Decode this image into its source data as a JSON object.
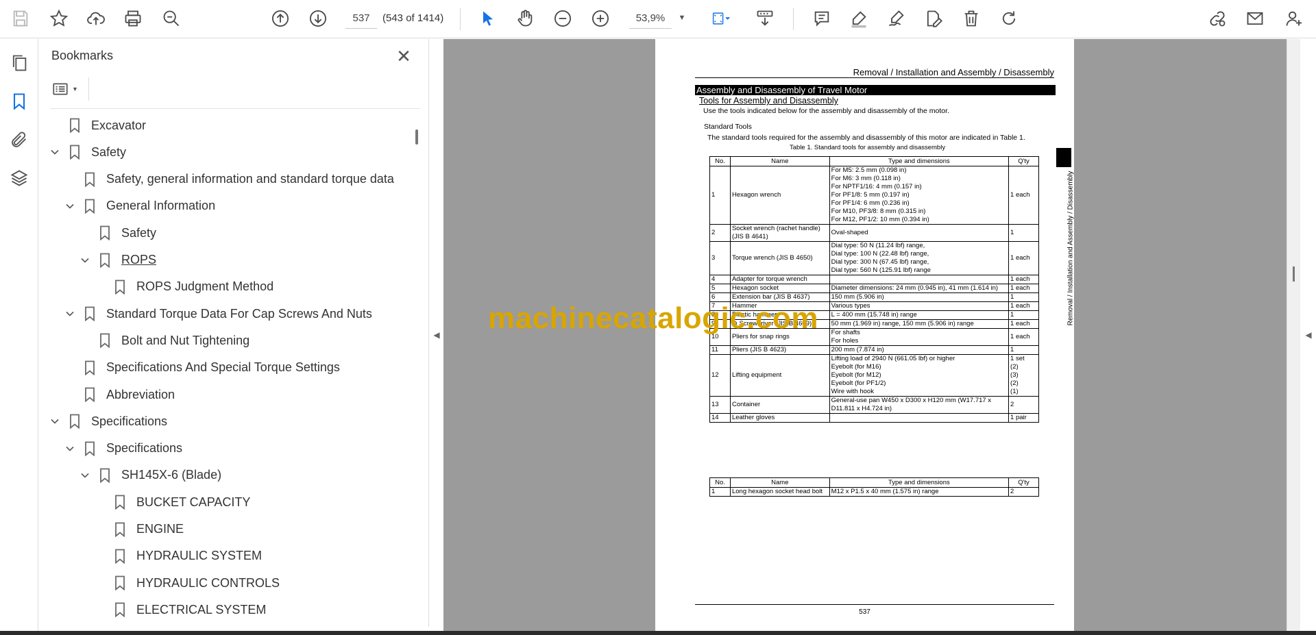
{
  "toolbar": {
    "page_number": "537",
    "page_count": "(543 of 1414)",
    "zoom": "53,9%"
  },
  "panel": {
    "title": "Bookmarks",
    "items": [
      {
        "label": "Excavator",
        "level": 0,
        "expanded": null
      },
      {
        "label": "Safety",
        "level": 0,
        "expanded": true
      },
      {
        "label": "Safety, general information and standard torque data",
        "level": 1,
        "expanded": null
      },
      {
        "label": "General Information",
        "level": 1,
        "expanded": true
      },
      {
        "label": "Safety",
        "level": 2,
        "expanded": null
      },
      {
        "label": "ROPS",
        "level": 2,
        "expanded": true
      },
      {
        "label": "ROPS Judgment Method",
        "level": 3,
        "expanded": null
      },
      {
        "label": "Standard Torque Data For Cap Screws And Nuts",
        "level": 1,
        "expanded": true
      },
      {
        "label": "Bolt and Nut Tightening",
        "level": 2,
        "expanded": null
      },
      {
        "label": "Specifications And Special Torque Settings",
        "level": 1,
        "expanded": null
      },
      {
        "label": "Abbreviation",
        "level": 1,
        "expanded": null
      },
      {
        "label": "Specifications",
        "level": 0,
        "expanded": true
      },
      {
        "label": "Specifications",
        "level": 1,
        "expanded": true
      },
      {
        "label": "SH145X-6 (Blade)",
        "level": 2,
        "expanded": true
      },
      {
        "label": "BUCKET CAPACITY",
        "level": 3,
        "expanded": null
      },
      {
        "label": "ENGINE",
        "level": 3,
        "expanded": null
      },
      {
        "label": "HYDRAULIC SYSTEM",
        "level": 3,
        "expanded": null
      },
      {
        "label": "HYDRAULIC CONTROLS",
        "level": 3,
        "expanded": null
      },
      {
        "label": "ELECTRICAL SYSTEM",
        "level": 3,
        "expanded": null
      }
    ]
  },
  "document": {
    "header": "Removal / Installation and Assembly / Disassembly",
    "section_title": "Assembly and Disassembly of Travel Motor",
    "subsection_title": "Tools for Assembly and Disassembly",
    "intro": "Use the tools indicated below for the assembly and disassembly of the motor.",
    "standard_tools_heading": "Standard Tools",
    "standard_tools_text": "The standard tools required for the assembly and disassembly of this motor are indicated in Table 1.",
    "table_caption": "Table 1. Standard tools for assembly and disassembly",
    "side_label": "Removal / Installation and Assembly / Disassembly",
    "columns": [
      "No.",
      "Name",
      "Type and dimensions",
      "Q'ty"
    ],
    "table1": [
      {
        "no": "1",
        "name": "Hexagon wrench",
        "type": [
          "For M5: 2.5 mm (0.098 in)",
          "For M6: 3 mm (0.118 in)",
          "For NPTF1/16: 4 mm (0.157 in)",
          "For PF1/8: 5 mm (0.197 in)",
          "For PF1/4: 6 mm (0.236 in)",
          "For M10, PF3/8: 8 mm (0.315 in)",
          "For M12, PF1/2: 10 mm (0.394 in)"
        ],
        "qty": [
          "1 each"
        ]
      },
      {
        "no": "2",
        "name": "Socket wrench (rachet handle) (JIS B 4641)",
        "type": [
          "Oval-shaped"
        ],
        "qty": [
          "1"
        ]
      },
      {
        "no": "3",
        "name": "Torque wrench (JIS B 4650)",
        "type": [
          "Dial type: 50 N (11.24 lbf) range,",
          "Dial type: 100 N (22.48 lbf) range,",
          "Dial type: 300 N (67.45 lbf) range,",
          "Dial type: 560 N (125.91 lbf) range"
        ],
        "qty": [
          "1 each"
        ]
      },
      {
        "no": "4",
        "name": "Adapter for torque wrench",
        "type": [
          ""
        ],
        "qty": [
          "1 each"
        ]
      },
      {
        "no": "5",
        "name": "Hexagon socket",
        "type": [
          "Diameter dimensions: 24 mm (0.945 in), 41 mm (1.614 in)"
        ],
        "qty": [
          "1 each"
        ]
      },
      {
        "no": "6",
        "name": "Extension bar (JIS B 4637)",
        "type": [
          "150 mm (5.906 in)"
        ],
        "qty": [
          "1"
        ]
      },
      {
        "no": "7",
        "name": "Hammer",
        "type": [
          "Various types"
        ],
        "qty": [
          "1 each"
        ]
      },
      {
        "no": "8",
        "name": "Plastic hammer",
        "type": [
          "L = 400 mm (15.748 in) range"
        ],
        "qty": [
          "1"
        ]
      },
      {
        "no": "9",
        "name": "⊖ Screwdriver (JIS B 4609)",
        "type": [
          "50 mm (1.969 in) range, 150 mm (5.906 in) range"
        ],
        "qty": [
          "1 each"
        ]
      },
      {
        "no": "10",
        "name": "Pliers for snap rings",
        "type": [
          "For shafts",
          "For holes"
        ],
        "qty": [
          "1 each"
        ]
      },
      {
        "no": "11",
        "name": "Pliers (JIS B 4623)",
        "type": [
          "200 mm (7.874 in)"
        ],
        "qty": [
          "1"
        ]
      },
      {
        "no": "12",
        "name": "Lifting equipment",
        "type": [
          "Lifting load of 2940 N (661.05 lbf) or higher",
          "Eyebolt (for M16)",
          "Eyebolt (for M12)",
          "Eyebolt (for PF1/2)",
          "Wire with hook"
        ],
        "qty": [
          "1 set",
          "(2)",
          "(3)",
          "(2)",
          "(1)"
        ]
      },
      {
        "no": "13",
        "name": "Container",
        "type": [
          "General-use pan W450 x D300 x H120 mm (W17.717 x D11.811 x H4.724 in)"
        ],
        "qty": [
          "2"
        ]
      },
      {
        "no": "14",
        "name": "Leather gloves",
        "type": [
          ""
        ],
        "qty": [
          "1 pair"
        ]
      }
    ],
    "table2": [
      {
        "no": "1",
        "name": "Long hexagon socket head bolt",
        "type": [
          "M12 x P1.5 x 40 mm (1.575 in) range"
        ],
        "qty": [
          "2"
        ]
      }
    ],
    "page_number": "537",
    "watermark": "machinecatalogic.com"
  }
}
